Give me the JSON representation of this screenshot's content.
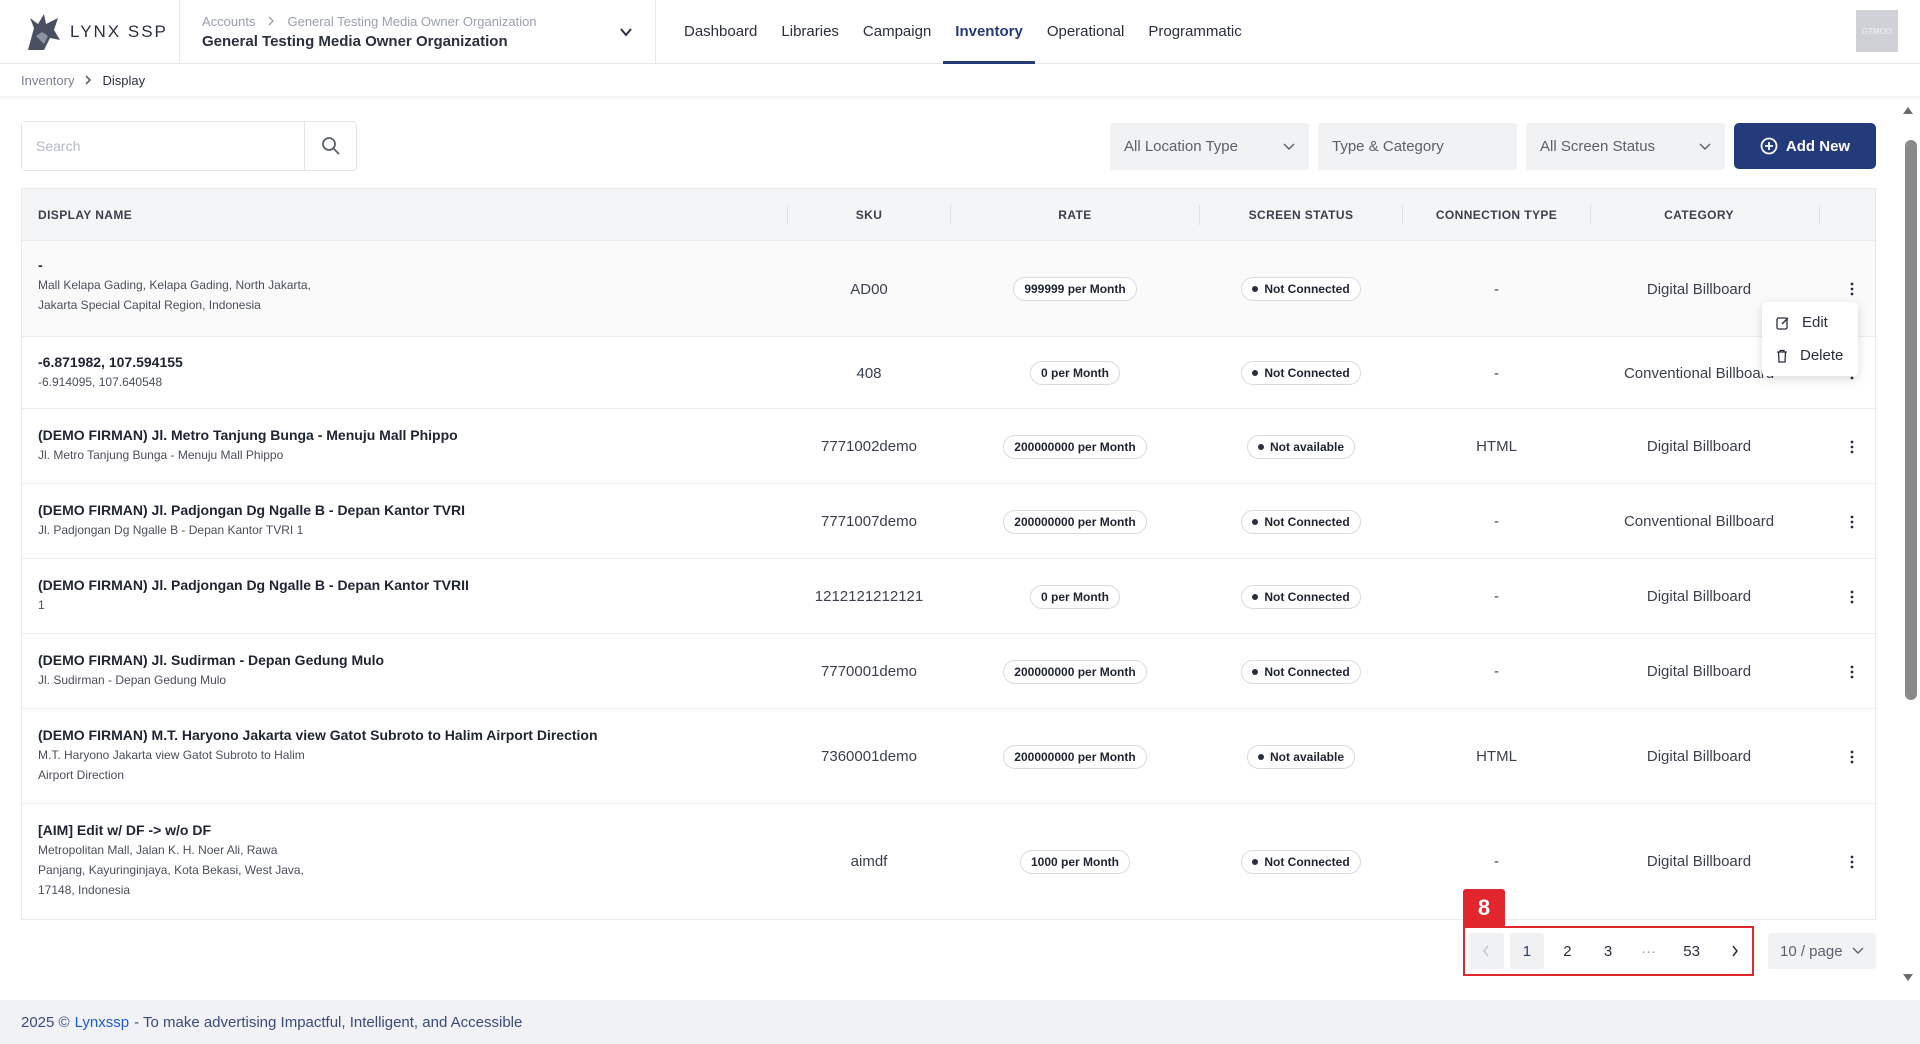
{
  "header": {
    "brand": "LYNX SSP",
    "org_crumb_root": "Accounts",
    "org_crumb_child": "General Testing Media Owner Organization",
    "org_name": "General Testing Media Owner Organization",
    "nav": [
      "Dashboard",
      "Libraries",
      "Campaign",
      "Inventory",
      "Operational",
      "Programmatic"
    ],
    "active_nav": "Inventory",
    "avatar_text": "GTMOO"
  },
  "breadcrumb": {
    "parent": "Inventory",
    "current": "Display"
  },
  "toolbar": {
    "search_placeholder": "Search",
    "location_filter": "All Location Type",
    "type_filter": "Type & Category",
    "status_filter": "All Screen Status",
    "add_label": "Add New"
  },
  "table": {
    "columns": [
      "DISPLAY NAME",
      "SKU",
      "RATE",
      "SCREEN STATUS",
      "CONNECTION TYPE",
      "CATEGORY"
    ],
    "rows": [
      {
        "name": "-",
        "address": "Mall Kelapa Gading, Kelapa Gading, North Jakarta,\nJakarta Special Capital Region, Indonesia",
        "sku": "AD00",
        "rate": "999999 per Month",
        "status": "Not Connected",
        "connection": "-",
        "category": "Digital Billboard"
      },
      {
        "name": "-6.871982, 107.594155",
        "address": "-6.914095, 107.640548",
        "sku": "408",
        "rate": "0 per Month",
        "status": "Not Connected",
        "connection": "-",
        "category": "Conventional Billboard"
      },
      {
        "name": "(DEMO FIRMAN) Jl. Metro Tanjung Bunga - Menuju Mall Phippo",
        "address": "Jl. Metro Tanjung Bunga - Menuju Mall Phippo",
        "sku": "7771002demo",
        "rate": "200000000 per Month",
        "status": "Not available",
        "connection": "HTML",
        "category": "Digital Billboard"
      },
      {
        "name": "(DEMO FIRMAN) Jl. Padjongan Dg Ngalle B - Depan Kantor TVRI",
        "address": "Jl. Padjongan Dg Ngalle B - Depan Kantor TVRI 1",
        "sku": "7771007demo",
        "rate": "200000000 per Month",
        "status": "Not Connected",
        "connection": "-",
        "category": "Conventional Billboard"
      },
      {
        "name": "(DEMO FIRMAN) Jl. Padjongan Dg Ngalle B - Depan Kantor TVRII",
        "address": "1",
        "sku": "1212121212121",
        "rate": "0 per Month",
        "status": "Not Connected",
        "connection": "-",
        "category": "Digital Billboard"
      },
      {
        "name": "(DEMO FIRMAN) Jl. Sudirman - Depan Gedung Mulo",
        "address": "Jl. Sudirman - Depan Gedung Mulo",
        "sku": "7770001demo",
        "rate": "200000000 per Month",
        "status": "Not Connected",
        "connection": "-",
        "category": "Digital Billboard"
      },
      {
        "name": "(DEMO FIRMAN) M.T. Haryono Jakarta view Gatot Subroto to Halim Airport Direction",
        "address": "M.T. Haryono Jakarta view Gatot Subroto to Halim\nAirport Direction",
        "sku": "7360001demo",
        "rate": "200000000 per Month",
        "status": "Not available",
        "connection": "HTML",
        "category": "Digital Billboard"
      },
      {
        "name": "[AIM] Edit w/ DF -> w/o DF",
        "address": "Metropolitan Mall, Jalan K. H. Noer Ali, Rawa\nPanjang, Kayuringinjaya, Kota Bekasi, West Java,\n17148, Indonesia",
        "sku": "aimdf",
        "rate": "1000 per Month",
        "status": "Not Connected",
        "connection": "-",
        "category": "Digital Billboard"
      }
    ]
  },
  "context_menu": {
    "edit": "Edit",
    "delete": "Delete"
  },
  "pagination": {
    "tag": "8",
    "pages": [
      "1",
      "2",
      "3",
      "···",
      "53"
    ],
    "current": "1",
    "per_page": "10 / page"
  },
  "footer": {
    "prefix": "2025 ©",
    "brand": "Lynxssp",
    "tagline": "- To make advertising Impactful, Intelligent, and Accessible"
  },
  "colors": {
    "primary": "#233a7b",
    "highlight": "#e1262e",
    "link": "#1e5bd6"
  }
}
